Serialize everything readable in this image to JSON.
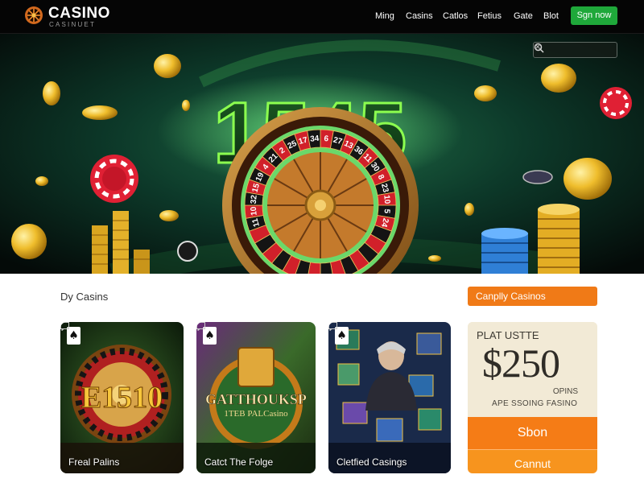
{
  "header": {
    "logo_main": "CASINO",
    "logo_sub": "CASINUET",
    "nav": [
      "Ming",
      "Casins",
      "Catlos",
      "Fetius",
      "Gate",
      "Blot"
    ],
    "signup_label": "Sgn now"
  },
  "hero": {
    "big_text": "1545",
    "search": {
      "value": "",
      "placeholder": ""
    },
    "roulette_numbers": [
      "11",
      "10",
      "32",
      "15",
      "19",
      "4",
      "21",
      "2",
      "25",
      "17",
      "34",
      "6",
      "27",
      "13",
      "36",
      "11",
      "30",
      "8",
      "23",
      "10",
      "5",
      "24"
    ]
  },
  "section": {
    "title": "Dy Casins",
    "pill_label": "Canplly Casinos"
  },
  "cards": [
    {
      "label": "Freal Palins",
      "suit": "♠",
      "art_text": "E1510"
    },
    {
      "label": "Catct The Folge",
      "suit": "♠",
      "art_text": "GATTHOUKSP",
      "art_sub": "1TEB PALCasino"
    },
    {
      "label": "Cletfied Casings",
      "suit": "♠"
    }
  ],
  "promo": {
    "kicker": "PLAT USTTE",
    "amount": "$250",
    "line2": "OPINS",
    "line3": "APE SSOING FASINO",
    "btn_primary": "Sbon",
    "btn_secondary": "Cannut"
  },
  "colors": {
    "header_bg": "#050505",
    "signup_green": "#1fa83a",
    "accent_orange": "#f07a17",
    "neon_green": "#3fd24a",
    "gold": "#e9b52a"
  }
}
